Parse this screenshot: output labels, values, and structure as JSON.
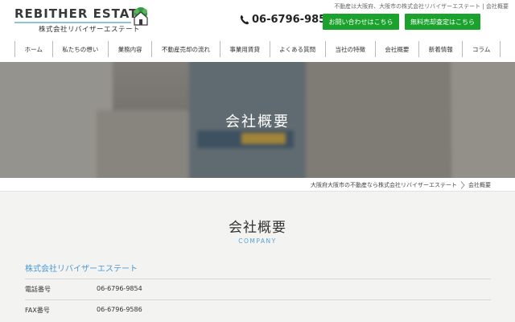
{
  "header": {
    "tagline": "不動産は大阪府、大阪市の株式会社リバイザーエステート | 会社概要",
    "logo_text": "REBITHER ESTATE",
    "logo_subtext": "株式会社リバイザーエステート",
    "phone": "06-6796-9854",
    "contact_button": "お問い合わせはこちら",
    "appraisal_button": "無料売却査定はこちら",
    "brand_color": "#1aa22c",
    "nav": [
      "ホーム",
      "私たちの想い",
      "業務内容",
      "不動産売却の流れ",
      "事業用賃貸",
      "よくある質問",
      "当社の特徴",
      "会社概要",
      "新着情報",
      "コラム"
    ]
  },
  "hero": {
    "title": "会社概要"
  },
  "breadcrumb": {
    "home": "大阪府大阪市の不動産なら株式会社リバイザーエステート",
    "current": "会社概要"
  },
  "content": {
    "title": "会社概要",
    "subtitle": "COMPANY",
    "company_name": "株式会社リバイザーエステート",
    "accent_color": "#4a9bd6",
    "rows": [
      {
        "label": "電話番号",
        "value": "06-6796-9854"
      },
      {
        "label": "FAX番号",
        "value": "06-6796-9586"
      }
    ]
  },
  "icons": {
    "logo": "house-leaf-icon",
    "phone": "phone-icon",
    "breadcrumb_separator": "chevron-right-icon"
  }
}
